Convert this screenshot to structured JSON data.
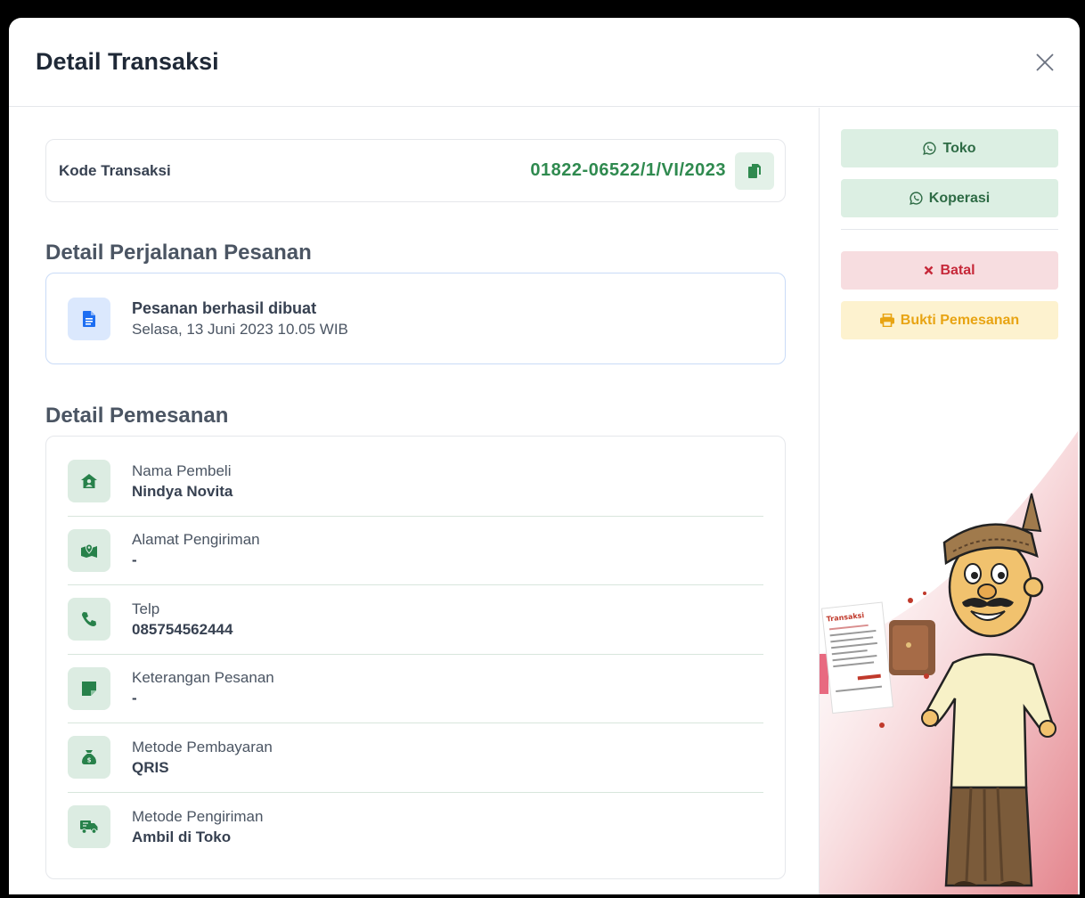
{
  "modal": {
    "title": "Detail Transaksi"
  },
  "kode": {
    "label": "Kode Transaksi",
    "value": "01822-06522/1/VI/2023"
  },
  "journey": {
    "title": "Detail Perjalanan Pesanan",
    "status": "Pesanan berhasil dibuat",
    "datetime": "Selasa, 13 Juni 2023 10.05 WIB"
  },
  "pemesanan": {
    "title": "Detail Pemesanan",
    "rows": [
      {
        "label": "Nama Pembeli",
        "value": "Nindya Novita",
        "icon": "house-user-icon"
      },
      {
        "label": "Alamat Pengiriman",
        "value": "-",
        "icon": "map-pin-icon"
      },
      {
        "label": "Telp",
        "value": "085754562444",
        "icon": "phone-icon"
      },
      {
        "label": "Keterangan Pesanan",
        "value": "-",
        "icon": "sticky-note-icon"
      },
      {
        "label": "Metode Pembayaran",
        "value": "QRIS",
        "icon": "money-bag-icon"
      },
      {
        "label": "Metode Pengiriman",
        "value": "Ambil di Toko",
        "icon": "truck-icon"
      }
    ]
  },
  "side": {
    "toko_label": "Toko",
    "koperasi_label": "Koperasi",
    "batal_label": "Batal",
    "bukti_label": "Bukti Pemesanan"
  },
  "illustration": {
    "receipt_text": "Transaksi"
  },
  "colors": {
    "accent_green": "#2f8a4f",
    "danger": "#c62839",
    "warning": "#e8a413",
    "info": "#1d6ef2"
  }
}
